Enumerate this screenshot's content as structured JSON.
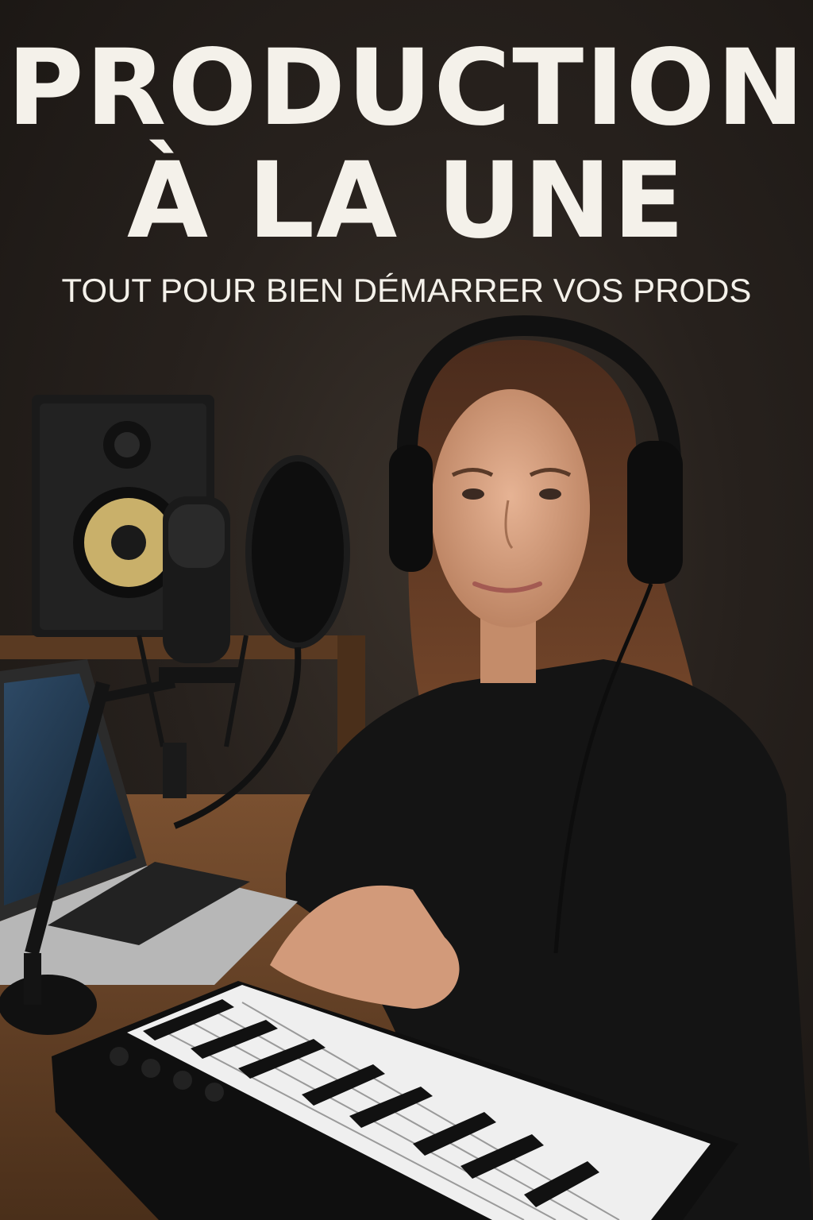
{
  "poster": {
    "headline_line1": "PRODUCTION",
    "headline_line2": "À LA UNE",
    "subtitle": "TOUT POUR BIEN DÉMARRER VOS PRODS"
  },
  "palette": {
    "background": "#27211d",
    "text": "#f4f1ea",
    "speaker_cone": "#c9b06a",
    "desk": "#6b4526"
  },
  "scene_objects": [
    "studio-monitor-speaker",
    "condenser-microphone",
    "pop-filter",
    "laptop",
    "midi-keyboard",
    "headphones",
    "person"
  ]
}
